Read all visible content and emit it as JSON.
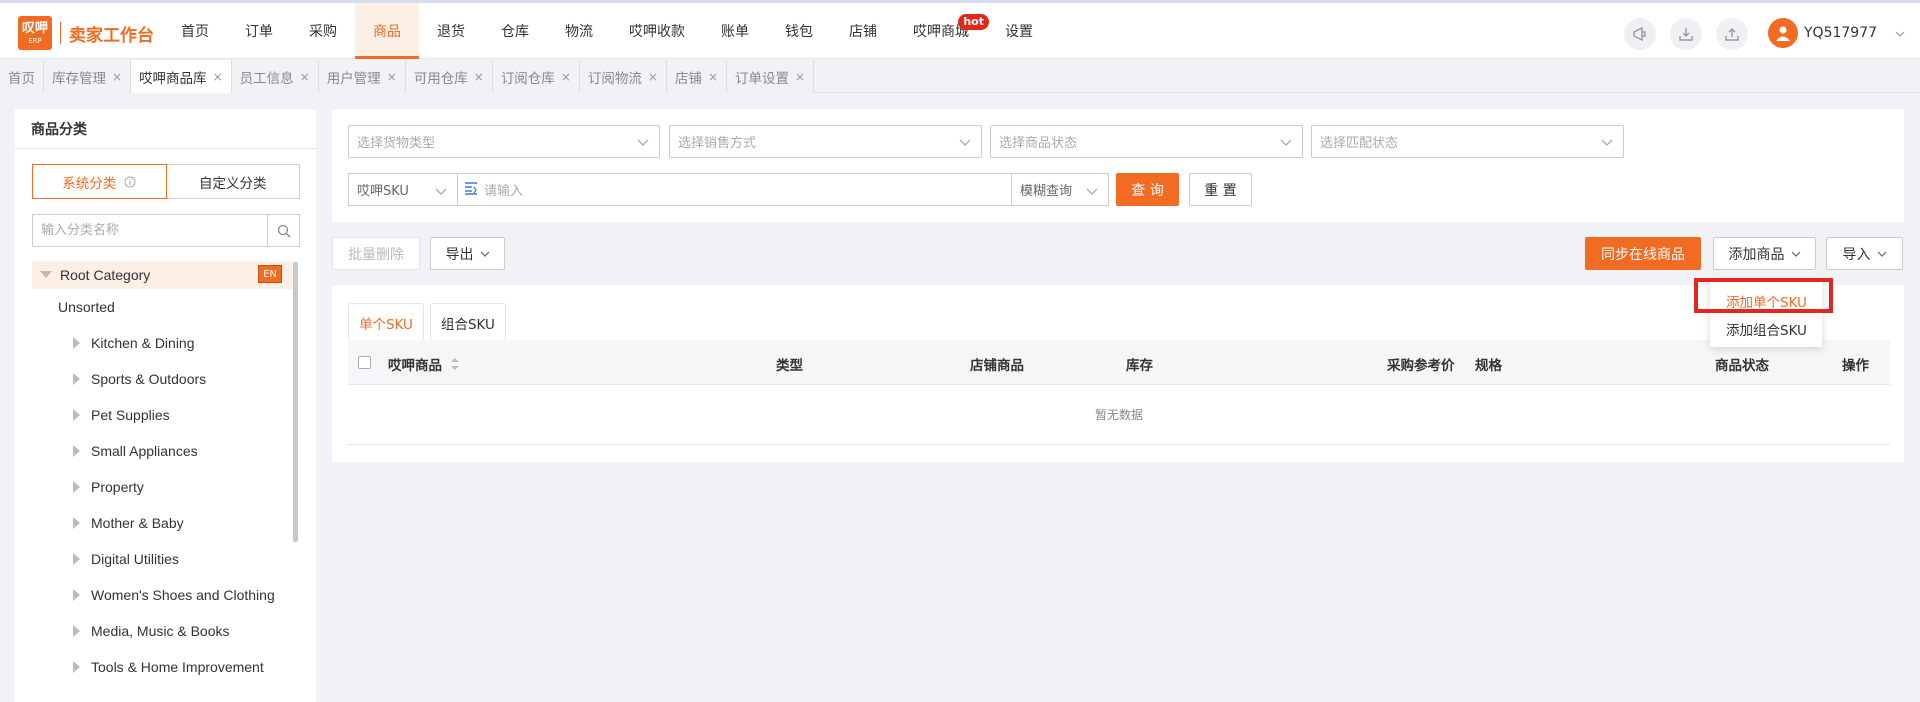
{
  "logo": {
    "mark_line1": "叹呷",
    "mark_line2": "ERP",
    "text": "卖家工作台"
  },
  "nav": [
    {
      "label": "首页"
    },
    {
      "label": "订单"
    },
    {
      "label": "采购"
    },
    {
      "label": "商品"
    },
    {
      "label": "退货"
    },
    {
      "label": "仓库"
    },
    {
      "label": "物流"
    },
    {
      "label": "哎呷收款"
    },
    {
      "label": "账单"
    },
    {
      "label": "钱包"
    },
    {
      "label": "店铺"
    },
    {
      "label": "哎呷商城"
    },
    {
      "label": "设置"
    }
  ],
  "nav_active": "商品",
  "hot_badge": "hot",
  "user": {
    "name": "YQ517977"
  },
  "page_tabs": [
    {
      "label": "首页"
    },
    {
      "label": "库存管理",
      "close": "×"
    },
    {
      "label": "哎呷商品库",
      "close": "×"
    },
    {
      "label": "员工信息",
      "close": "×"
    },
    {
      "label": "用户管理",
      "close": "×"
    },
    {
      "label": "可用仓库",
      "close": "×"
    },
    {
      "label": "订阅仓库",
      "close": "×"
    },
    {
      "label": "订阅物流",
      "close": "×"
    },
    {
      "label": "店铺",
      "close": "×"
    },
    {
      "label": "订单设置",
      "close": "×"
    }
  ],
  "sidebar": {
    "title": "商品分类",
    "seg_system": "系统分类",
    "seg_custom": "自定义分类",
    "search_placeholder": "输入分类名称",
    "root_label": "Root Category",
    "en_badge": "EN",
    "unsorted": "Unsorted",
    "categories": [
      "Kitchen & Dining",
      "Sports & Outdoors",
      "Pet Supplies",
      "Small Appliances",
      "Property",
      "Mother & Baby",
      "Digital Utilities",
      "Women's Shoes and Clothing",
      "Media, Music & Books",
      "Tools & Home Improvement"
    ]
  },
  "filters": {
    "goods_type": "选择货物类型",
    "sale_method": "选择销售方式",
    "product_status": "选择商品状态",
    "match_status": "选择匹配状态",
    "sku_type": "哎呷SKU",
    "input_placeholder": "请输入",
    "fuzzy": "模糊查询",
    "query": "查 询",
    "reset": "重 置"
  },
  "actions": {
    "batch_delete": "批量删除",
    "export": "导出",
    "sync": "同步在线商品",
    "add": "添加商品",
    "import": "导入"
  },
  "table": {
    "tab_single": "单个SKU",
    "tab_combo": "组合SKU",
    "columns": {
      "product": "哎呷商品",
      "type": "类型",
      "store_product": "店铺商品",
      "stock": "库存",
      "ref_price": "采购参考价",
      "spec": "规格",
      "status": "商品状态",
      "ops": "操作"
    },
    "empty": "暂无数据"
  },
  "dropdown": {
    "single": "添加单个SKU",
    "combo": "添加组合SKU"
  },
  "colors": {
    "accent": "#f26b22",
    "highlight_box": "#e42620"
  }
}
